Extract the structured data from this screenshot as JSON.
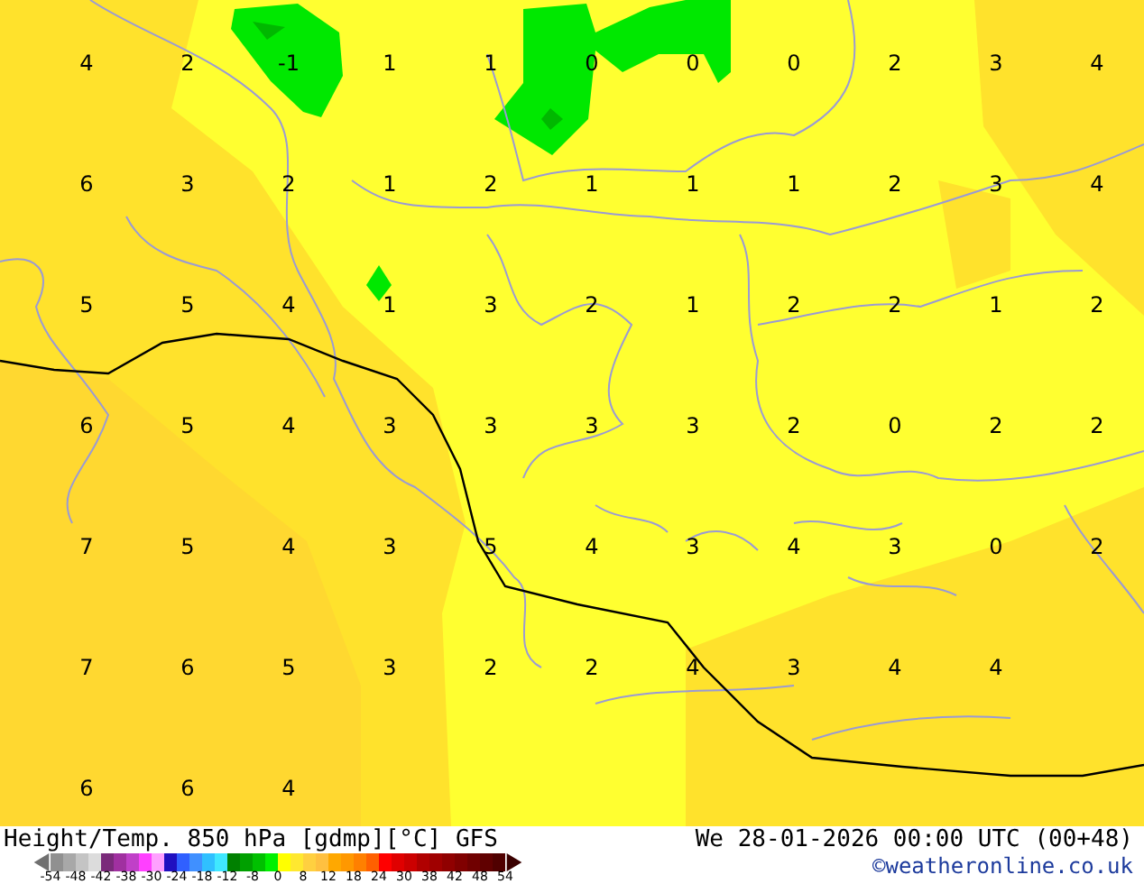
{
  "map": {
    "value_rows": [
      [
        "4",
        "2",
        "-1",
        "1",
        "1",
        "0",
        "0",
        "0",
        "2",
        "3",
        "4"
      ],
      [
        "6",
        "3",
        "2",
        "1",
        "2",
        "1",
        "1",
        "1",
        "2",
        "3",
        "4"
      ],
      [
        "5",
        "5",
        "4",
        "1",
        "3",
        "2",
        "1",
        "2",
        "2",
        "1",
        "2"
      ],
      [
        "6",
        "5",
        "4",
        "3",
        "3",
        "3",
        "3",
        "2",
        "0",
        "2",
        "2"
      ],
      [
        "7",
        "5",
        "4",
        "3",
        "5",
        "4",
        "3",
        "4",
        "3",
        "0",
        "2"
      ],
      [
        "7",
        "6",
        "5",
        "3",
        "2",
        "2",
        "4",
        "3",
        "4",
        "4"
      ],
      [
        "6",
        "6",
        "4"
      ]
    ]
  },
  "footer": {
    "title": "Height/Temp. 850 hPa [gdmp][°C] GFS",
    "valid_time": "We 28-01-2026 00:00 UTC (00+48)",
    "credit": "©weatheronline.co.uk",
    "legend": {
      "swatches": [
        {
          "color": "#909090"
        },
        {
          "color": "#a8a8a8"
        },
        {
          "color": "#c4c4c4"
        },
        {
          "color": "#dcdcdc"
        },
        {
          "color": "#7a2a7a"
        },
        {
          "color": "#a030a0"
        },
        {
          "color": "#c040c8"
        },
        {
          "color": "#ff40ff"
        },
        {
          "color": "#ffa0ff"
        },
        {
          "color": "#2010c0"
        },
        {
          "color": "#3060ff"
        },
        {
          "color": "#4090ff"
        },
        {
          "color": "#30c0ff"
        },
        {
          "color": "#40e8ff"
        },
        {
          "color": "#008000"
        },
        {
          "color": "#00a000"
        },
        {
          "color": "#00c000"
        },
        {
          "color": "#00f000"
        },
        {
          "color": "#ffff00"
        },
        {
          "color": "#ffe830"
        },
        {
          "color": "#ffd040"
        },
        {
          "color": "#ffc040"
        },
        {
          "color": "#ffa800"
        },
        {
          "color": "#ff9800"
        },
        {
          "color": "#ff8000"
        },
        {
          "color": "#ff6000"
        },
        {
          "color": "#ff0000"
        },
        {
          "color": "#e00000"
        },
        {
          "color": "#cc0000"
        },
        {
          "color": "#b00000"
        },
        {
          "color": "#a00000"
        },
        {
          "color": "#900000"
        },
        {
          "color": "#800000"
        },
        {
          "color": "#700000"
        },
        {
          "color": "#600000"
        },
        {
          "color": "#500000"
        }
      ],
      "tick_labels": [
        "-54",
        "-48",
        "-42",
        "-38",
        "-30",
        "-24",
        "-18",
        "-12",
        "-8",
        "0",
        "8",
        "12",
        "18",
        "24",
        "30",
        "38",
        "42",
        "48",
        "54"
      ]
    }
  }
}
